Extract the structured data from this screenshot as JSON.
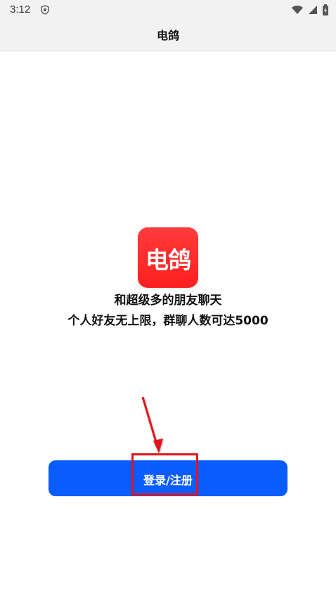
{
  "status_bar": {
    "time": "3:12"
  },
  "header": {
    "title": "电鸽"
  },
  "logo": {
    "text": "电鸽",
    "color": "#ff2a2a"
  },
  "taglines": [
    "和超级多的朋友聊天",
    "个人好友无上限，群聊人数可达5000"
  ],
  "login_button": {
    "label": "登录/注册",
    "color": "#0a5cff"
  },
  "annotation": {
    "highlight_color": "#e0151b"
  }
}
